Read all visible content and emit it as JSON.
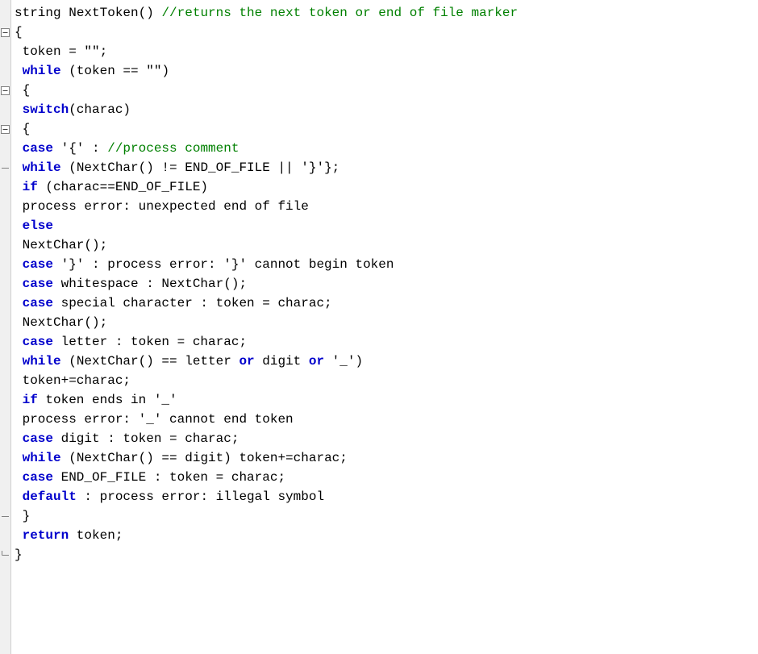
{
  "gutter": {
    "dash": "–",
    "boxminus": "boxminus",
    "corner": "corner"
  },
  "lines": [
    {
      "indent": 0,
      "g": "none",
      "parts": [
        {
          "c": "txt",
          "t": "string NextToken() "
        },
        {
          "c": "cm",
          "t": "//returns the next token or end of file marker"
        }
      ]
    },
    {
      "indent": 0,
      "g": "boxminus",
      "parts": [
        {
          "c": "txt",
          "t": "{"
        }
      ]
    },
    {
      "indent": 1,
      "g": "none",
      "parts": [
        {
          "c": "txt",
          "t": "token = "
        },
        {
          "c": "txt",
          "t": "\"\""
        },
        {
          "c": "txt",
          "t": ";"
        }
      ]
    },
    {
      "indent": 1,
      "g": "none",
      "parts": [
        {
          "c": "kw",
          "t": "while"
        },
        {
          "c": "txt",
          "t": " (token == "
        },
        {
          "c": "txt",
          "t": "\"\""
        },
        {
          "c": "txt",
          "t": ")"
        }
      ]
    },
    {
      "indent": 1,
      "g": "boxminus",
      "parts": [
        {
          "c": "txt",
          "t": "{"
        }
      ]
    },
    {
      "indent": 1,
      "g": "none",
      "parts": [
        {
          "c": "kw",
          "t": "switch"
        },
        {
          "c": "txt",
          "t": "(charac)"
        }
      ]
    },
    {
      "indent": 1,
      "g": "boxminus",
      "parts": [
        {
          "c": "txt",
          "t": "{"
        }
      ]
    },
    {
      "indent": 1,
      "g": "none",
      "parts": [
        {
          "c": "kw",
          "t": "case"
        },
        {
          "c": "txt",
          "t": " '{' : "
        },
        {
          "c": "cm",
          "t": "//process comment"
        }
      ]
    },
    {
      "indent": 1,
      "g": "dash",
      "parts": [
        {
          "c": "kw",
          "t": "while"
        },
        {
          "c": "txt",
          "t": " (NextChar() != END_OF_FILE || '}'};"
        }
      ]
    },
    {
      "indent": 1,
      "g": "none",
      "parts": [
        {
          "c": "kw",
          "t": "if"
        },
        {
          "c": "txt",
          "t": " (charac==END_OF_FILE)"
        }
      ]
    },
    {
      "indent": 1,
      "g": "none",
      "parts": [
        {
          "c": "txt",
          "t": "process error: unexpected end of file"
        }
      ]
    },
    {
      "indent": 1,
      "g": "none",
      "parts": [
        {
          "c": "kw",
          "t": "else"
        }
      ]
    },
    {
      "indent": 1,
      "g": "none",
      "parts": [
        {
          "c": "txt",
          "t": "NextChar();"
        }
      ]
    },
    {
      "indent": 1,
      "g": "none",
      "parts": [
        {
          "c": "kw",
          "t": "case"
        },
        {
          "c": "txt",
          "t": " '}' : process error: '}' cannot begin token"
        }
      ]
    },
    {
      "indent": 1,
      "g": "none",
      "parts": [
        {
          "c": "kw",
          "t": "case"
        },
        {
          "c": "txt",
          "t": " whitespace : NextChar();"
        }
      ]
    },
    {
      "indent": 1,
      "g": "none",
      "parts": [
        {
          "c": "kw",
          "t": "case"
        },
        {
          "c": "txt",
          "t": " special character : token = charac;"
        }
      ]
    },
    {
      "indent": 1,
      "g": "none",
      "parts": [
        {
          "c": "txt",
          "t": "NextChar();"
        }
      ]
    },
    {
      "indent": 1,
      "g": "none",
      "parts": [
        {
          "c": "kw",
          "t": "case"
        },
        {
          "c": "txt",
          "t": " letter : token = charac;"
        }
      ]
    },
    {
      "indent": 1,
      "g": "none",
      "parts": [
        {
          "c": "kw",
          "t": "while"
        },
        {
          "c": "txt",
          "t": " (NextChar() == letter "
        },
        {
          "c": "kw",
          "t": "or"
        },
        {
          "c": "txt",
          "t": " digit "
        },
        {
          "c": "kw",
          "t": "or"
        },
        {
          "c": "txt",
          "t": " '_')"
        }
      ]
    },
    {
      "indent": 1,
      "g": "none",
      "parts": [
        {
          "c": "txt",
          "t": "token+=charac;"
        }
      ]
    },
    {
      "indent": 1,
      "g": "none",
      "parts": [
        {
          "c": "kw",
          "t": "if"
        },
        {
          "c": "txt",
          "t": " token ends in '_'"
        }
      ]
    },
    {
      "indent": 1,
      "g": "none",
      "parts": [
        {
          "c": "txt",
          "t": "process error: '_' cannot end token"
        }
      ]
    },
    {
      "indent": 1,
      "g": "none",
      "parts": [
        {
          "c": "kw",
          "t": "case"
        },
        {
          "c": "txt",
          "t": " digit : token = charac;"
        }
      ]
    },
    {
      "indent": 1,
      "g": "none",
      "parts": [
        {
          "c": "kw",
          "t": "while"
        },
        {
          "c": "txt",
          "t": " (NextChar() == digit) token+=charac;"
        }
      ]
    },
    {
      "indent": 1,
      "g": "none",
      "parts": [
        {
          "c": "kw",
          "t": "case"
        },
        {
          "c": "txt",
          "t": " END_OF_FILE : token = charac;"
        }
      ]
    },
    {
      "indent": 1,
      "g": "none",
      "parts": [
        {
          "c": "kw",
          "t": "default"
        },
        {
          "c": "txt",
          "t": " : process error: illegal symbol"
        }
      ]
    },
    {
      "indent": 1,
      "g": "dash",
      "parts": [
        {
          "c": "txt",
          "t": "}"
        }
      ]
    },
    {
      "indent": 1,
      "g": "none",
      "parts": [
        {
          "c": "kw",
          "t": "return"
        },
        {
          "c": "txt",
          "t": " token;"
        }
      ]
    },
    {
      "indent": 0,
      "g": "corner",
      "parts": [
        {
          "c": "txt",
          "t": "}"
        }
      ]
    }
  ]
}
